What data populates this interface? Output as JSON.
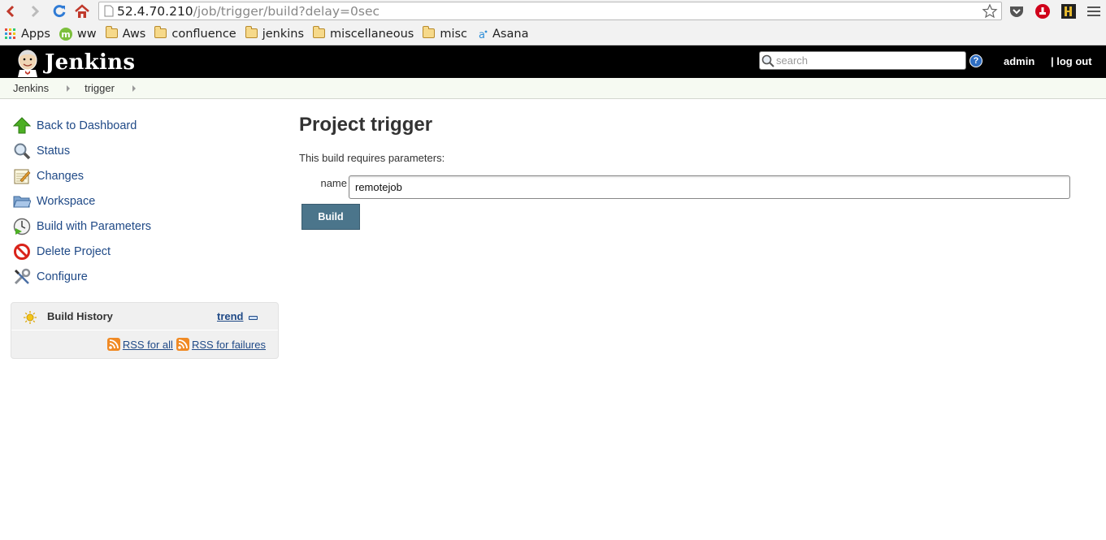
{
  "browser": {
    "url_host": "52.4.70.210",
    "url_path": "/job/trigger/build?delay=0sec",
    "bookmarks": [
      {
        "label": "Apps",
        "icon": "apps-grid-icon"
      },
      {
        "label": "ww",
        "icon": "ww-m-icon"
      },
      {
        "label": "Aws",
        "icon": "folder-icon"
      },
      {
        "label": "confluence",
        "icon": "folder-icon"
      },
      {
        "label": "jenkins",
        "icon": "folder-icon"
      },
      {
        "label": "miscellaneous",
        "icon": "folder-icon"
      },
      {
        "label": "misc",
        "icon": "folder-icon"
      },
      {
        "label": "Asana",
        "icon": "asana-icon"
      }
    ]
  },
  "header": {
    "title": "Jenkins",
    "search_placeholder": "search",
    "user": "admin",
    "logout": "| log out"
  },
  "breadcrumb": [
    "Jenkins",
    "trigger"
  ],
  "sidebar": {
    "tasks": [
      {
        "label": "Back to Dashboard",
        "icon": "up-arrow-icon"
      },
      {
        "label": "Status",
        "icon": "magnifier-icon"
      },
      {
        "label": "Changes",
        "icon": "notepad-icon"
      },
      {
        "label": "Workspace",
        "icon": "folder-open-icon"
      },
      {
        "label": "Build with Parameters",
        "icon": "clock-play-icon"
      },
      {
        "label": "Delete Project",
        "icon": "no-entry-icon"
      },
      {
        "label": "Configure",
        "icon": "wrench-screwdriver-icon"
      }
    ]
  },
  "build_history": {
    "title": "Build History",
    "trend": "trend",
    "rss_all": "RSS for all",
    "rss_failures": "RSS for failures"
  },
  "main": {
    "title": "Project trigger",
    "requires": "This build requires parameters:",
    "param_label": "name",
    "param_value": "remotejob",
    "build_button": "Build"
  },
  "colors": {
    "header_bg": "#000000",
    "link": "#204a87",
    "build_button": "#4b758b"
  }
}
